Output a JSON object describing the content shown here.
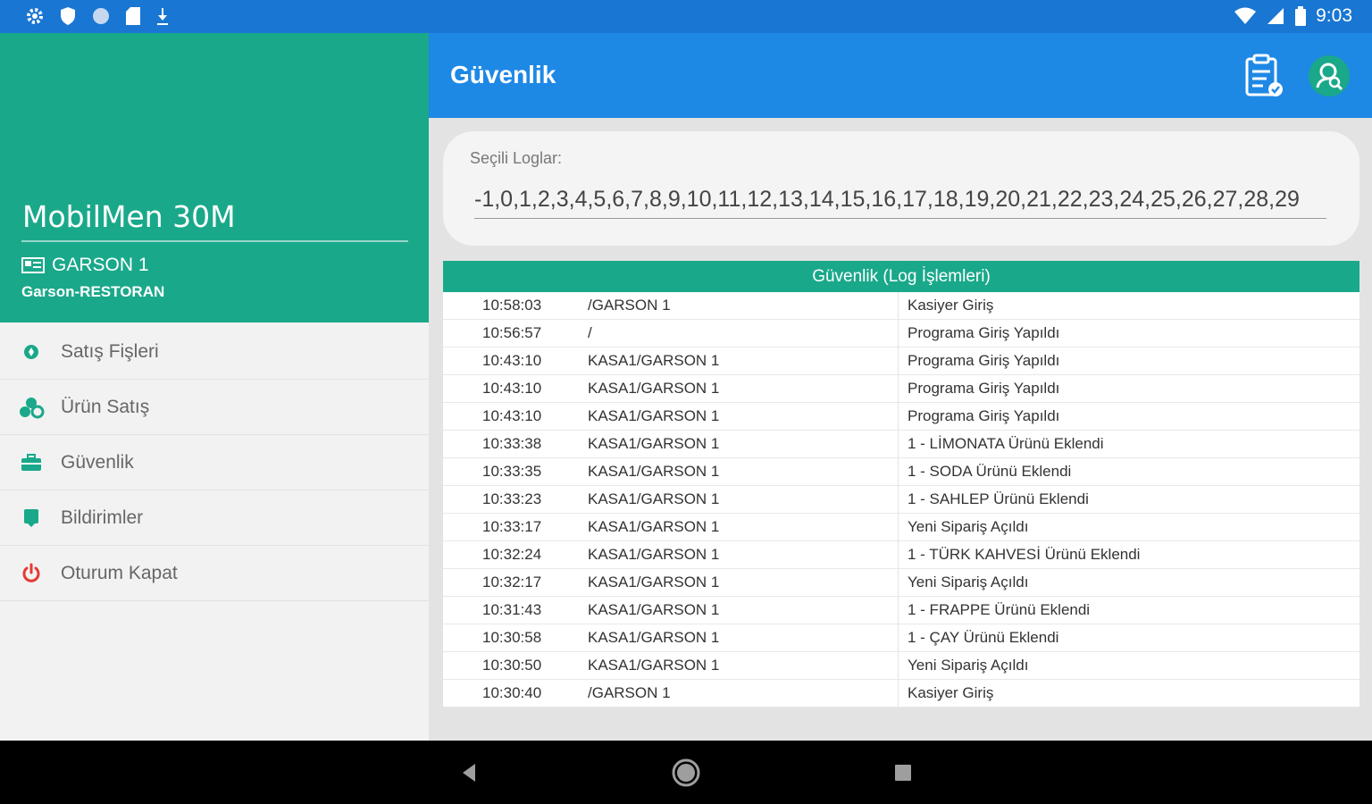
{
  "status_bar": {
    "time": "9:03",
    "left_icons": [
      "gear-icon",
      "shield-icon",
      "circle-icon",
      "sd-card-icon",
      "download-icon"
    ],
    "right_icons": [
      "wifi-icon",
      "signal-icon",
      "battery-icon"
    ]
  },
  "drawer": {
    "app_name": "MobilMen 30M",
    "user_name": "GARSON 1",
    "user_role": "Garson-RESTORAN",
    "items": [
      {
        "label": "Satış Fişleri",
        "icon": "receipt-icon",
        "color": "#1aa88a"
      },
      {
        "label": "Ürün Satış",
        "icon": "products-icon",
        "color": "#1aa88a"
      },
      {
        "label": "Güvenlik",
        "icon": "briefcase-icon",
        "color": "#1aa88a"
      },
      {
        "label": "Bildirimler",
        "icon": "notification-icon",
        "color": "#1aa88a"
      },
      {
        "label": "Oturum Kapat",
        "icon": "power-icon",
        "color": "#e53935"
      }
    ]
  },
  "toolbar": {
    "title": "Güvenlik",
    "actions": [
      "clipboard-check-icon",
      "user-search-icon"
    ]
  },
  "selected_logs": {
    "label": "Seçili Loglar:",
    "value": "-1,0,1,2,3,4,5,6,7,8,9,10,11,12,13,14,15,16,17,18,19,20,21,22,23,24,25,26,27,28,29"
  },
  "log_table": {
    "title": "Güvenlik (Log İşlemleri)",
    "rows": [
      {
        "time": "10:58:03",
        "user": "/GARSON 1",
        "action": "Kasiyer Giriş"
      },
      {
        "time": "10:56:57",
        "user": "/",
        "action": "Programa Giriş Yapıldı"
      },
      {
        "time": "10:43:10",
        "user": "KASA1/GARSON 1",
        "action": "Programa Giriş Yapıldı"
      },
      {
        "time": "10:43:10",
        "user": "KASA1/GARSON 1",
        "action": "Programa Giriş Yapıldı"
      },
      {
        "time": "10:43:10",
        "user": "KASA1/GARSON 1",
        "action": "Programa Giriş Yapıldı"
      },
      {
        "time": "10:33:38",
        "user": "KASA1/GARSON 1",
        "action": "1 - LİMONATA Ürünü Eklendi"
      },
      {
        "time": "10:33:35",
        "user": "KASA1/GARSON 1",
        "action": "1 - SODA Ürünü Eklendi"
      },
      {
        "time": "10:33:23",
        "user": "KASA1/GARSON 1",
        "action": "1 - SAHLEP Ürünü Eklendi"
      },
      {
        "time": "10:33:17",
        "user": "KASA1/GARSON 1",
        "action": "Yeni Sipariş Açıldı"
      },
      {
        "time": "10:32:24",
        "user": "KASA1/GARSON 1",
        "action": "1 - TÜRK KAHVESİ Ürünü Eklendi"
      },
      {
        "time": "10:32:17",
        "user": "KASA1/GARSON 1",
        "action": "Yeni Sipariş Açıldı"
      },
      {
        "time": "10:31:43",
        "user": "KASA1/GARSON 1",
        "action": "1 - FRAPPE Ürünü Eklendi"
      },
      {
        "time": "10:30:58",
        "user": "KASA1/GARSON 1",
        "action": "1 - ÇAY Ürünü Eklendi"
      },
      {
        "time": "10:30:50",
        "user": "KASA1/GARSON 1",
        "action": "Yeni Sipariş Açıldı"
      },
      {
        "time": "10:30:40",
        "user": "/GARSON 1",
        "action": "Kasiyer Giriş"
      }
    ]
  },
  "nav_bar": [
    "back-icon",
    "home-icon",
    "recents-icon"
  ],
  "colors": {
    "primary": "#1e88e5",
    "status_bar": "#1976d2",
    "accent": "#1aa88a",
    "danger": "#e53935"
  }
}
